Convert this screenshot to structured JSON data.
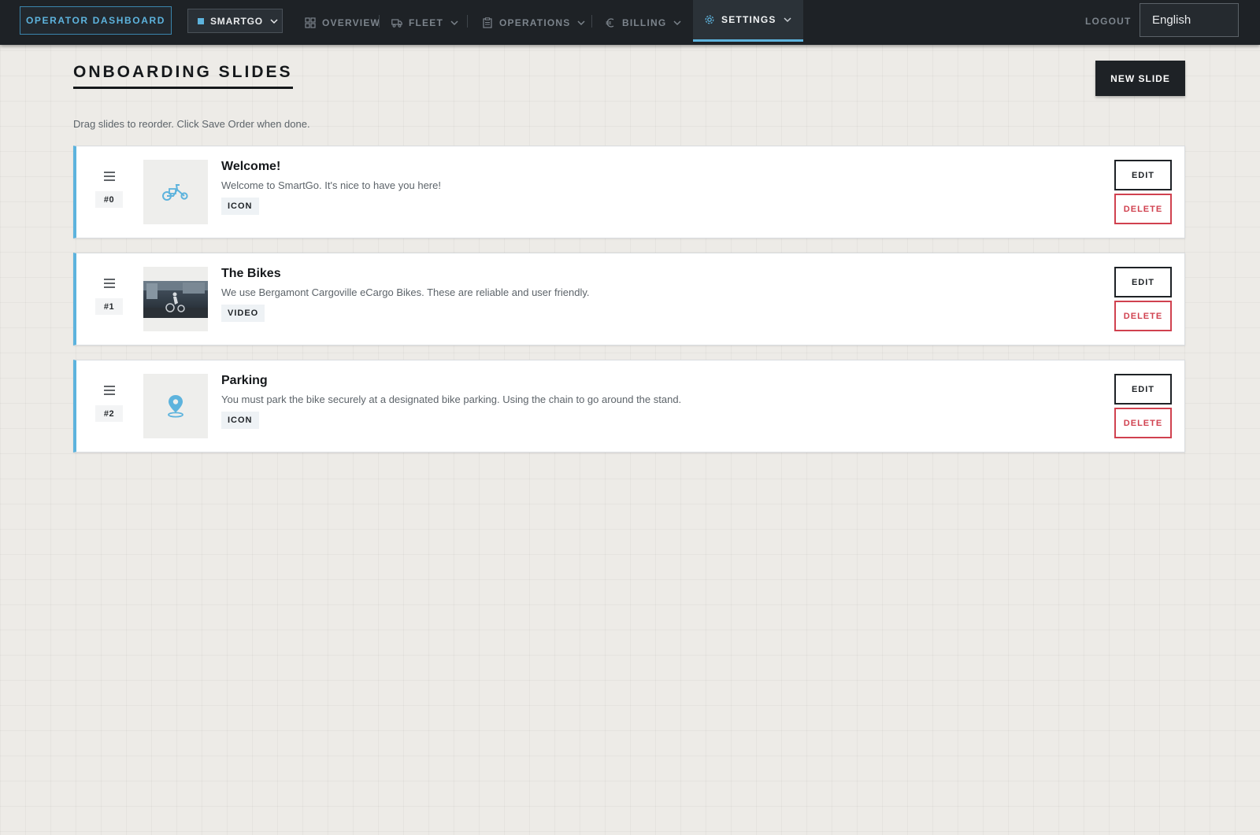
{
  "topbar": {
    "brand_label": "OPERATOR DASHBOARD",
    "org_label": "SMARTGO",
    "nav": [
      {
        "label": "OVERVIEW",
        "icon": "grid-icon"
      },
      {
        "label": "FLEET",
        "icon": "truck-icon"
      },
      {
        "label": "OPERATIONS",
        "icon": "clipboard-icon"
      },
      {
        "label": "BILLING",
        "icon": "euro-icon"
      },
      {
        "label": "SETTINGS",
        "icon": "gear-icon",
        "active": true
      }
    ],
    "logout_label": "LOGOUT",
    "language": "English"
  },
  "page": {
    "title": "ONBOARDING SLIDES",
    "new_slide_label": "NEW SLIDE",
    "hint": "Drag slides to reorder. Click Save Order when done."
  },
  "slides": [
    {
      "order": "#0",
      "title": "Welcome!",
      "description": "Welcome to SmartGo. It's nice to have you here!",
      "type": "ICON",
      "media": "cargo-bike-icon",
      "edit_label": "EDIT",
      "delete_label": "DELETE"
    },
    {
      "order": "#1",
      "title": "The Bikes",
      "description": "We use Bergamont Cargoville eCargo Bikes. These are reliable and user friendly.",
      "type": "VIDEO",
      "media": "video-thumbnail",
      "edit_label": "EDIT",
      "delete_label": "DELETE"
    },
    {
      "order": "#2",
      "title": "Parking",
      "description": "You must park the bike securely at a designated bike parking. Using the chain to go around the stand.",
      "type": "ICON",
      "media": "map-pin-icon",
      "edit_label": "EDIT",
      "delete_label": "DELETE"
    }
  ],
  "colors": {
    "accent": "#5db3dd",
    "danger": "#d0414f",
    "nav_bg": "#1e2226",
    "page_bg": "#edebe7"
  }
}
